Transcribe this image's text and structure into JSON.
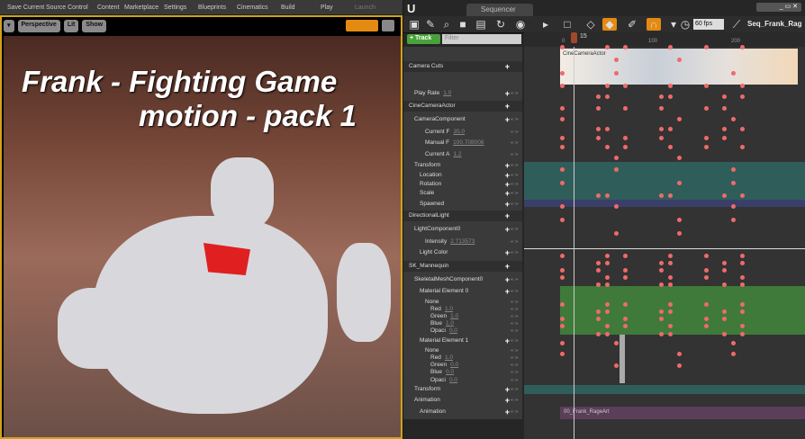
{
  "toolbar": {
    "items": [
      "Save Current",
      "Source Control",
      "Content",
      "Marketplace",
      "Settings",
      "Blueprints",
      "Cinematics",
      "Build",
      "Play",
      "Launch"
    ]
  },
  "viewport": {
    "perspective": "Perspective",
    "lit": "Lit",
    "show": "Show",
    "title_line1": "Frank - Fighting Game",
    "title_line2": "motion - pack 1"
  },
  "sequencer": {
    "tab": "Sequencer",
    "fps": "60 fps",
    "sequence_name": "Seq_Frank_Rag",
    "track_button": "+ Track",
    "filter_placeholder": "Filter",
    "current_frame": "15",
    "ruler": [
      "0",
      "100",
      "200"
    ],
    "camera_cut_label": "CineCameraActor",
    "anim_section_label": "00_Frank_RageArt"
  },
  "tracks": [
    {
      "label": "Camera Cuts",
      "indent": 0
    },
    {
      "label": "Play Rate",
      "value": "1.0",
      "indent": 1
    },
    {
      "label": "CineCameraActor",
      "indent": 0
    },
    {
      "label": "CameraComponent",
      "indent": 1
    },
    {
      "label": "Current F",
      "value": "35.0",
      "indent": 3
    },
    {
      "label": "Manual F",
      "value": "100.708008",
      "indent": 3
    },
    {
      "label": "Current A",
      "value": "1.2",
      "indent": 3
    },
    {
      "label": "Transform",
      "indent": 1
    },
    {
      "label": "Location",
      "indent": 2
    },
    {
      "label": "Rotation",
      "indent": 2
    },
    {
      "label": "Scale",
      "indent": 2
    },
    {
      "label": "Spawned",
      "indent": 2
    },
    {
      "label": "DirectionalLight",
      "indent": 0
    },
    {
      "label": "LightComponent0",
      "indent": 1
    },
    {
      "label": "Intensity",
      "value": "2.713573",
      "indent": 3
    },
    {
      "label": "Light Color",
      "indent": 2
    },
    {
      "label": "SK_Mannequin",
      "indent": 0
    },
    {
      "label": "SkeletalMeshComponent0",
      "indent": 1
    },
    {
      "label": "Material Element 0",
      "indent": 2
    },
    {
      "label": "None",
      "indent": 3
    },
    {
      "label": "Red",
      "value": "1.0",
      "indent": 4
    },
    {
      "label": "Green",
      "value": "1.0",
      "indent": 4
    },
    {
      "label": "Blue",
      "value": "1.0",
      "indent": 4
    },
    {
      "label": "Opaci",
      "value": "0.0",
      "indent": 4
    },
    {
      "label": "Material Element 1",
      "indent": 2
    },
    {
      "label": "None",
      "indent": 3
    },
    {
      "label": "Red",
      "value": "1.0",
      "indent": 4
    },
    {
      "label": "Green",
      "value": "0.0",
      "indent": 4
    },
    {
      "label": "Blue",
      "value": "0.0",
      "indent": 4
    },
    {
      "label": "Opaci",
      "value": "0.0",
      "indent": 4
    },
    {
      "label": "Transform",
      "indent": 1
    },
    {
      "label": "Animation",
      "indent": 1
    },
    {
      "label": "Animation",
      "indent": 2
    }
  ]
}
